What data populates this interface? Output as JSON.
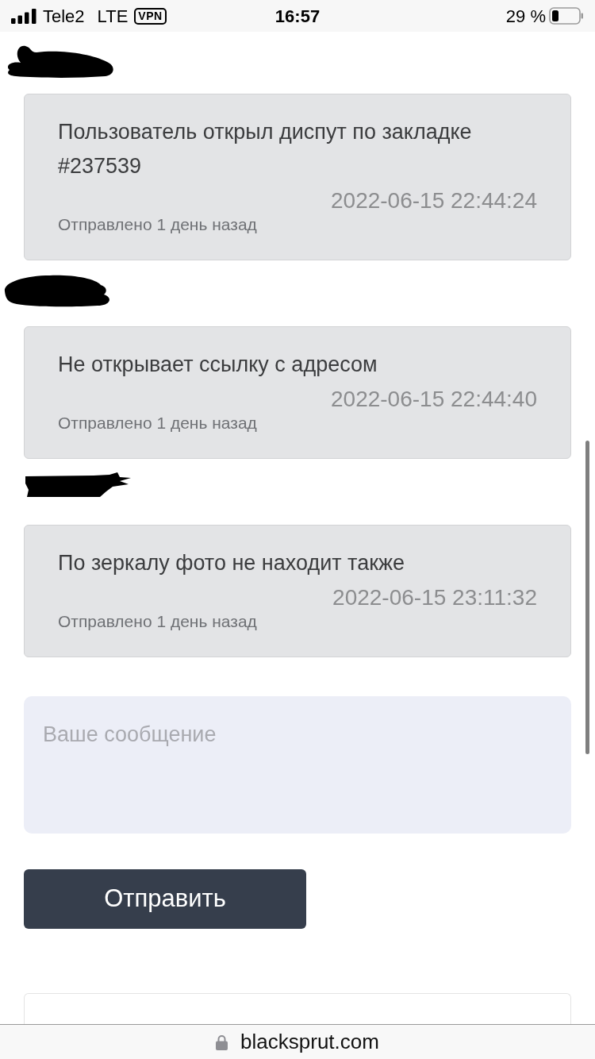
{
  "status_bar": {
    "carrier": "Tele2",
    "network": "LTE",
    "vpn": "VPN",
    "time": "16:57",
    "battery": "29 %"
  },
  "messages": [
    {
      "author_redacted": true,
      "text": "Пользователь открыл диспут по закладке #237539",
      "timestamp": "2022-06-15 22:44:24",
      "sent": "Отправлено 1 день назад"
    },
    {
      "author_redacted": true,
      "text": "Не открывает ссылку с адресом",
      "timestamp": "2022-06-15 22:44:40",
      "sent": "Отправлено 1 день назад"
    },
    {
      "author_redacted": true,
      "text": "По зеркалу фото не находит также",
      "timestamp": "2022-06-15 23:11:32",
      "sent": "Отправлено 1 день назад"
    }
  ],
  "reply_form": {
    "placeholder": "Ваше сообщение",
    "submit": "Отправить"
  },
  "browser_bar": {
    "address": "blacksprut.com"
  }
}
